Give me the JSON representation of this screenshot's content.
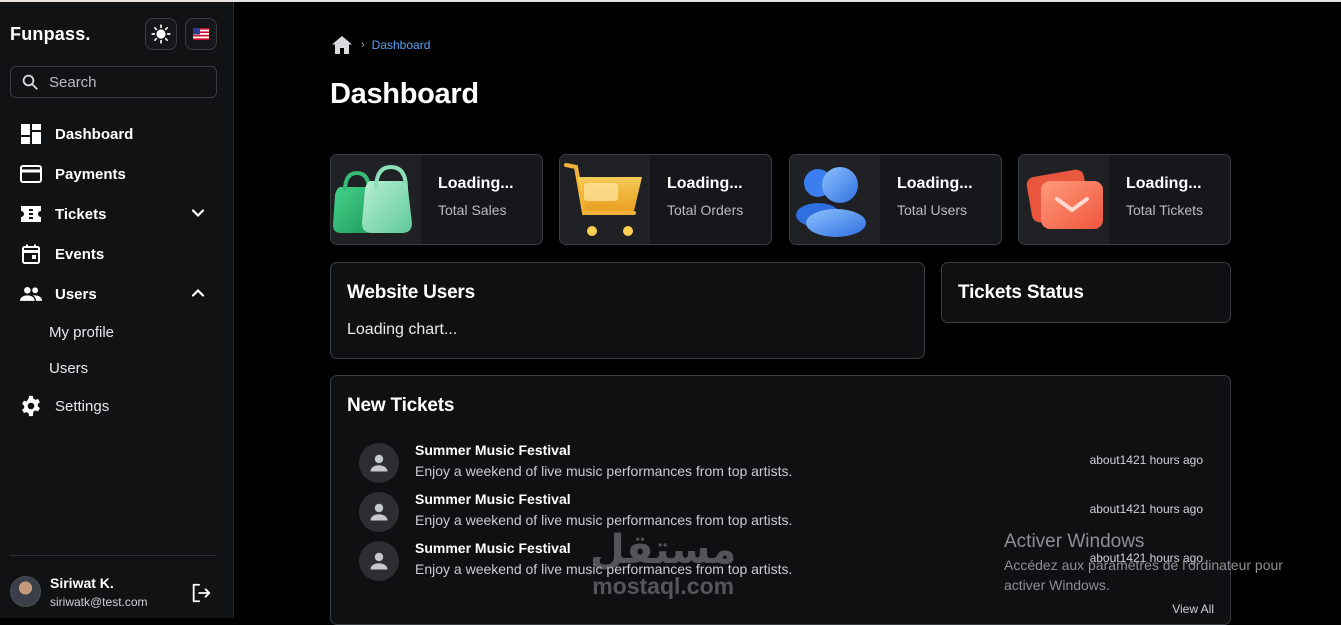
{
  "app": {
    "brand": "Funpass.",
    "theme_icon": "sun-icon",
    "language_icon": "us-flag-icon"
  },
  "search": {
    "placeholder": "Search",
    "icon": "search-icon"
  },
  "sidebar": {
    "items": [
      {
        "label": "Dashboard",
        "icon": "dashboard-icon"
      },
      {
        "label": "Payments",
        "icon": "credit-card-icon"
      },
      {
        "label": "Tickets",
        "icon": "ticket-icon",
        "expanded": false
      },
      {
        "label": "Events",
        "icon": "calendar-icon"
      },
      {
        "label": "Users",
        "icon": "users-icon",
        "expanded": true,
        "children": [
          "My profile",
          "Users"
        ]
      },
      {
        "label": "Settings",
        "icon": "gear-icon"
      }
    ]
  },
  "user": {
    "name": "Siriwat K.",
    "email": "siriwatk@test.com"
  },
  "breadcrumb": {
    "current": "Dashboard"
  },
  "page": {
    "title": "Dashboard"
  },
  "stats": [
    {
      "value": "Loading...",
      "label": "Total Sales",
      "icon": "shopping-bags-icon"
    },
    {
      "value": "Loading...",
      "label": "Total Orders",
      "icon": "shopping-cart-icon"
    },
    {
      "value": "Loading...",
      "label": "Total Users",
      "icon": "users-3d-icon"
    },
    {
      "value": "Loading...",
      "label": "Total Tickets",
      "icon": "envelope-3d-icon"
    }
  ],
  "website_users": {
    "title": "Website Users",
    "loading": "Loading chart..."
  },
  "tickets_status": {
    "title": "Tickets Status"
  },
  "new_tickets": {
    "title": "New Tickets",
    "items": [
      {
        "title": "Summer Music Festival",
        "description": "Enjoy a weekend of live music performances from top artists.",
        "time": "about1421 hours ago"
      },
      {
        "title": "Summer Music Festival",
        "description": "Enjoy a weekend of live music performances from top artists.",
        "time": "about1421 hours ago"
      },
      {
        "title": "Summer Music Festival",
        "description": "Enjoy a weekend of live music performances from top artists.",
        "time": "about1421 hours ago"
      }
    ],
    "view_all": "View All"
  },
  "watermark": {
    "arabic": "مستقل",
    "latin": "mostaql.com"
  },
  "windows_activation": {
    "title": "Activer Windows",
    "line1": "Accédez aux paramètres de l'ordinateur pour",
    "line2": "activer Windows."
  },
  "colors": {
    "background": "#000000",
    "sidebar": "#111214",
    "accent_link": "#5aa3f0",
    "card_border": "#3a3d42"
  }
}
